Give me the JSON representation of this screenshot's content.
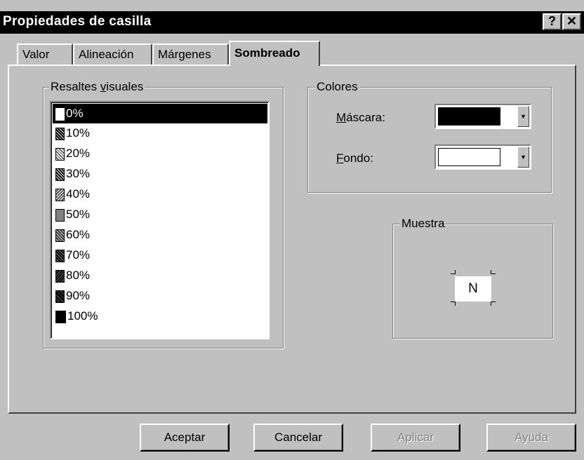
{
  "window": {
    "title": "Propiedades de casilla",
    "help_btn": "?",
    "close_btn": "✕"
  },
  "tabs": [
    {
      "label": "Valor"
    },
    {
      "label": "Alineación"
    },
    {
      "label": "Márgenes"
    },
    {
      "label": "Sombreado",
      "active": true
    }
  ],
  "highlights": {
    "title_pre": "Resaltes ",
    "title_accel": "v",
    "title_post": "isuales",
    "items": [
      {
        "label": "0%",
        "selected": true
      },
      {
        "label": "10%"
      },
      {
        "label": "20%"
      },
      {
        "label": "30%"
      },
      {
        "label": "40%"
      },
      {
        "label": "50%"
      },
      {
        "label": "60%"
      },
      {
        "label": "70%"
      },
      {
        "label": "80%"
      },
      {
        "label": "90%"
      },
      {
        "label": "100%"
      }
    ]
  },
  "colors": {
    "title": "Colores",
    "mask_accel": "M",
    "mask_rest": "áscara:",
    "mask_color": "#000000",
    "bg_accel": "F",
    "bg_rest": "ondo:",
    "bg_color": "#ffffff"
  },
  "sample": {
    "title": "Muestra",
    "text": "N"
  },
  "buttons": {
    "ok": "Aceptar",
    "cancel": "Cancelar",
    "apply": "Aplicar",
    "help": "Ayuda"
  }
}
